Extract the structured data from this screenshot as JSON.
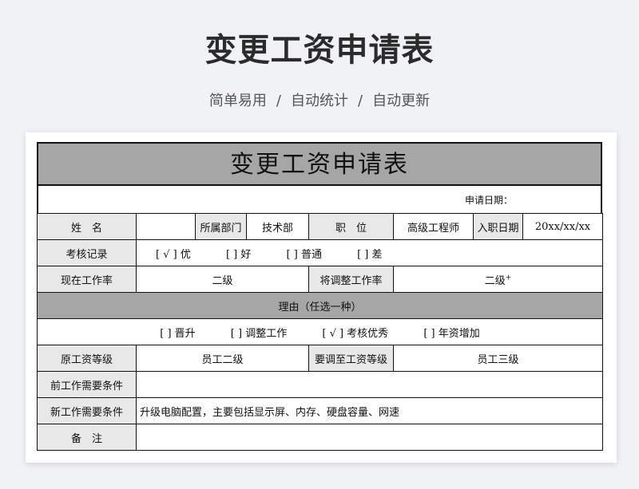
{
  "hero": {
    "title": "变更工资申请表",
    "sub": [
      "简单易用",
      "自动统计",
      "自动更新"
    ],
    "sep": "/"
  },
  "doc": {
    "title": "变更工资申请表",
    "apply_date_label": "申请日期：",
    "name_label": "姓　名",
    "dept_label": "所属部门",
    "dept_value": "技术部",
    "position_label": "职　位",
    "position_value": "高级工程师",
    "join_label": "入职日期",
    "join_value": "20xx/xx/xx",
    "review_label": "考核记录",
    "review_options": [
      "[ √ ] 优",
      "[ ] 好",
      "[ ] 普通",
      "[ ] 差"
    ],
    "current_rate_label": "现在工作率",
    "current_rate_value": "二级",
    "target_rate_label": "将调整工作率",
    "target_rate_value": "二级",
    "target_rate_mark": "+",
    "reason_label": "理由（任选一种）",
    "reason_options": [
      "[ ] 晋升",
      "[ ] 调整工作",
      "[ √ ] 考核优秀",
      "[ ] 年资增加"
    ],
    "orig_grade_label": "原工资等级",
    "orig_grade_value": "员工二级",
    "new_grade_label": "要调至工资等级",
    "new_grade_value": "员工三级",
    "prev_cond_label": "前工作需要条件",
    "prev_cond_value": "",
    "new_cond_label": "新工作需要条件",
    "new_cond_value": "升级电脑配置，主要包括显示屏、内存、硬盘容量、网速",
    "remark_label": "备　注"
  }
}
